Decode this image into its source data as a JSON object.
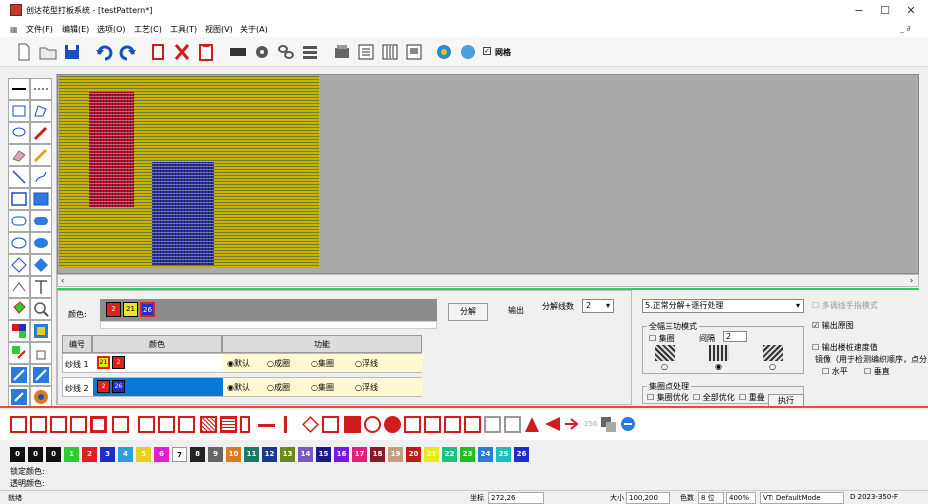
{
  "window": {
    "title": "创达花型打板系统 - [testPattern*]",
    "min": "−",
    "max": "☐",
    "close": "✕",
    "inner_ctrl": "_ ∂"
  },
  "menu": [
    "文件(F)",
    "编辑(E)",
    "选项(O)",
    "工艺(C)",
    "工具(T)",
    "视图(V)",
    "关于(A)"
  ],
  "toolbar": {
    "grid_label": "网格"
  },
  "panel": {
    "color_label": "颜色:",
    "colors": [
      {
        "num": "2",
        "color": "#e0201c"
      },
      {
        "num": "21",
        "color": "#e8e81a"
      },
      {
        "num": "26",
        "color": "#1f2ec8"
      }
    ],
    "split_btn": "分解",
    "output_btn": "输出",
    "split_count_label": "分解线数",
    "split_count_value": "2",
    "table_headers": [
      "编号",
      "颜色",
      "功能"
    ],
    "rows": [
      {
        "name": "纱线 1",
        "c1": "21",
        "c1color": "#e8e81a",
        "c2": "2",
        "c2color": "#e0201c",
        "selected": false
      },
      {
        "name": "纱线 2",
        "c1": "2",
        "c1color": "#e0201c",
        "c2": "26",
        "c2color": "#1f2ec8",
        "selected": true
      }
    ],
    "functions": [
      "默认",
      "成圈",
      "集圈",
      "浮线"
    ]
  },
  "right_panel": {
    "mode_select": "5.正常分解+逐行处理",
    "multi_finger": "多调线手指模式",
    "triple_title": "全幅三功模式",
    "gather_label": "集圈",
    "spacing_label": "间隔",
    "spacing_value": "2",
    "output_pattern": "输出原图",
    "output_speed": "输出楼桩速度值",
    "mirror_note": "镜像（用于检测编织顺序，点分",
    "horizontal": "水平",
    "vertical": "垂直",
    "gather_proc_title": "集圈点处理",
    "gather_opt": "集圈优化",
    "all_opt": "全部优化",
    "overlap": "重叠",
    "execute": "执行"
  },
  "palette": [
    {
      "n": "0",
      "c": "#111111"
    },
    {
      "n": "0",
      "c": "#111111"
    },
    {
      "n": "0",
      "c": "#111111"
    },
    {
      "n": "1",
      "c": "#2ecc2e"
    },
    {
      "n": "2",
      "c": "#e0201c"
    },
    {
      "n": "3",
      "c": "#1f2ec8"
    },
    {
      "n": "4",
      "c": "#2ba0e0"
    },
    {
      "n": "5",
      "c": "#e8d020"
    },
    {
      "n": "6",
      "c": "#e020c8"
    },
    {
      "n": "7",
      "c": "#ffffff",
      "t": "#000"
    },
    {
      "n": "8",
      "c": "#222222"
    },
    {
      "n": "9",
      "c": "#666666"
    },
    {
      "n": "10",
      "c": "#e07a20"
    },
    {
      "n": "11",
      "c": "#1a7a6a"
    },
    {
      "n": "12",
      "c": "#1a3a8a"
    },
    {
      "n": "13",
      "c": "#6a8a1a"
    },
    {
      "n": "14",
      "c": "#7a5ac0"
    },
    {
      "n": "15",
      "c": "#1a1a8a"
    },
    {
      "n": "16",
      "c": "#7a1ae0"
    },
    {
      "n": "17",
      "c": "#e0207a"
    },
    {
      "n": "18",
      "c": "#8a1a2a"
    },
    {
      "n": "19",
      "c": "#c0a080"
    },
    {
      "n": "20",
      "c": "#c01a1a"
    },
    {
      "n": "21",
      "c": "#e8e81a"
    },
    {
      "n": "22",
      "c": "#20c080"
    },
    {
      "n": "23",
      "c": "#20c020"
    },
    {
      "n": "24",
      "c": "#2a7ae0"
    },
    {
      "n": "25",
      "c": "#1ac0c0"
    },
    {
      "n": "26",
      "c": "#1f2ec8"
    }
  ],
  "labels": {
    "locked": "锁定颜色:",
    "transparent": "透明颜色:"
  },
  "status": {
    "ready": "就绪",
    "coord_label": "坐标",
    "coord_value": "272,26",
    "size_label": "大小",
    "size_value": "100,200",
    "color_depth_label": "色数",
    "color_depth_value": "8 位",
    "zoom": "400%",
    "mode": "VT: DefaultMode",
    "build": "D 2023-350-F"
  }
}
